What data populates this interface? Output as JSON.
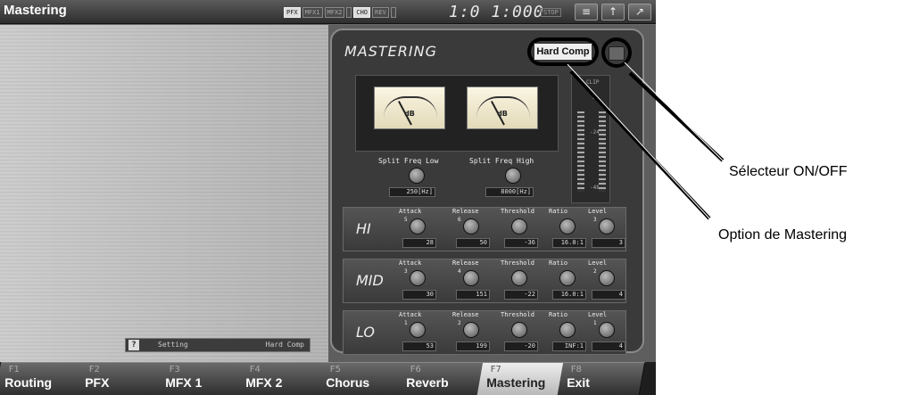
{
  "titlebar": {
    "title": "Mastering",
    "fx_badges": [
      {
        "label": "PFX",
        "on": true
      },
      {
        "label": "MFX1",
        "on": false
      },
      {
        "label": "MFX2",
        "on": false
      },
      {
        "label": "",
        "on": false
      },
      {
        "label": "CHO",
        "on": true
      },
      {
        "label": "REV",
        "on": false
      },
      {
        "label": "",
        "on": false
      }
    ],
    "time": "1:0 1:000",
    "transport_state": "STOP"
  },
  "status": {
    "label": "Setting",
    "value": "Hard Comp"
  },
  "mastering": {
    "title": "MASTERING",
    "option": "Hard Comp",
    "meter_unit": "dB",
    "clip_label": "CLIP",
    "clip_scale": [
      "-6",
      "-24",
      "-48"
    ],
    "split_low_label": "Split Freq Low",
    "split_low_value": "250[Hz]",
    "split_high_label": "Split Freq High",
    "split_high_value": "8000[Hz]",
    "param_labels": [
      "Attack",
      "Release",
      "Threshold",
      "Ratio",
      "Level"
    ],
    "bands": [
      {
        "name": "HI",
        "nums": [
          "5",
          "6",
          "",
          "",
          "3"
        ],
        "values": [
          "28",
          "50",
          "-36",
          "16.0:1",
          "3"
        ]
      },
      {
        "name": "MID",
        "nums": [
          "3",
          "4",
          "",
          "",
          "2"
        ],
        "values": [
          "30",
          "151",
          "-22",
          "16.0:1",
          "4"
        ]
      },
      {
        "name": "LO",
        "nums": [
          "1",
          "2",
          "",
          "",
          "1"
        ],
        "values": [
          "53",
          "199",
          "-20",
          "INF:1",
          "4"
        ]
      }
    ]
  },
  "function_keys": [
    {
      "num": "F1",
      "label": "Routing"
    },
    {
      "num": "F2",
      "label": "PFX"
    },
    {
      "num": "F3",
      "label": "MFX 1"
    },
    {
      "num": "F4",
      "label": "MFX 2"
    },
    {
      "num": "F5",
      "label": "Chorus"
    },
    {
      "num": "F6",
      "label": "Reverb"
    },
    {
      "num": "F7",
      "label": "Mastering",
      "active": true
    },
    {
      "num": "F8",
      "label": "Exit"
    }
  ],
  "callouts": {
    "onoff": "Sélecteur ON/OFF",
    "option": "Option de Mastering"
  }
}
